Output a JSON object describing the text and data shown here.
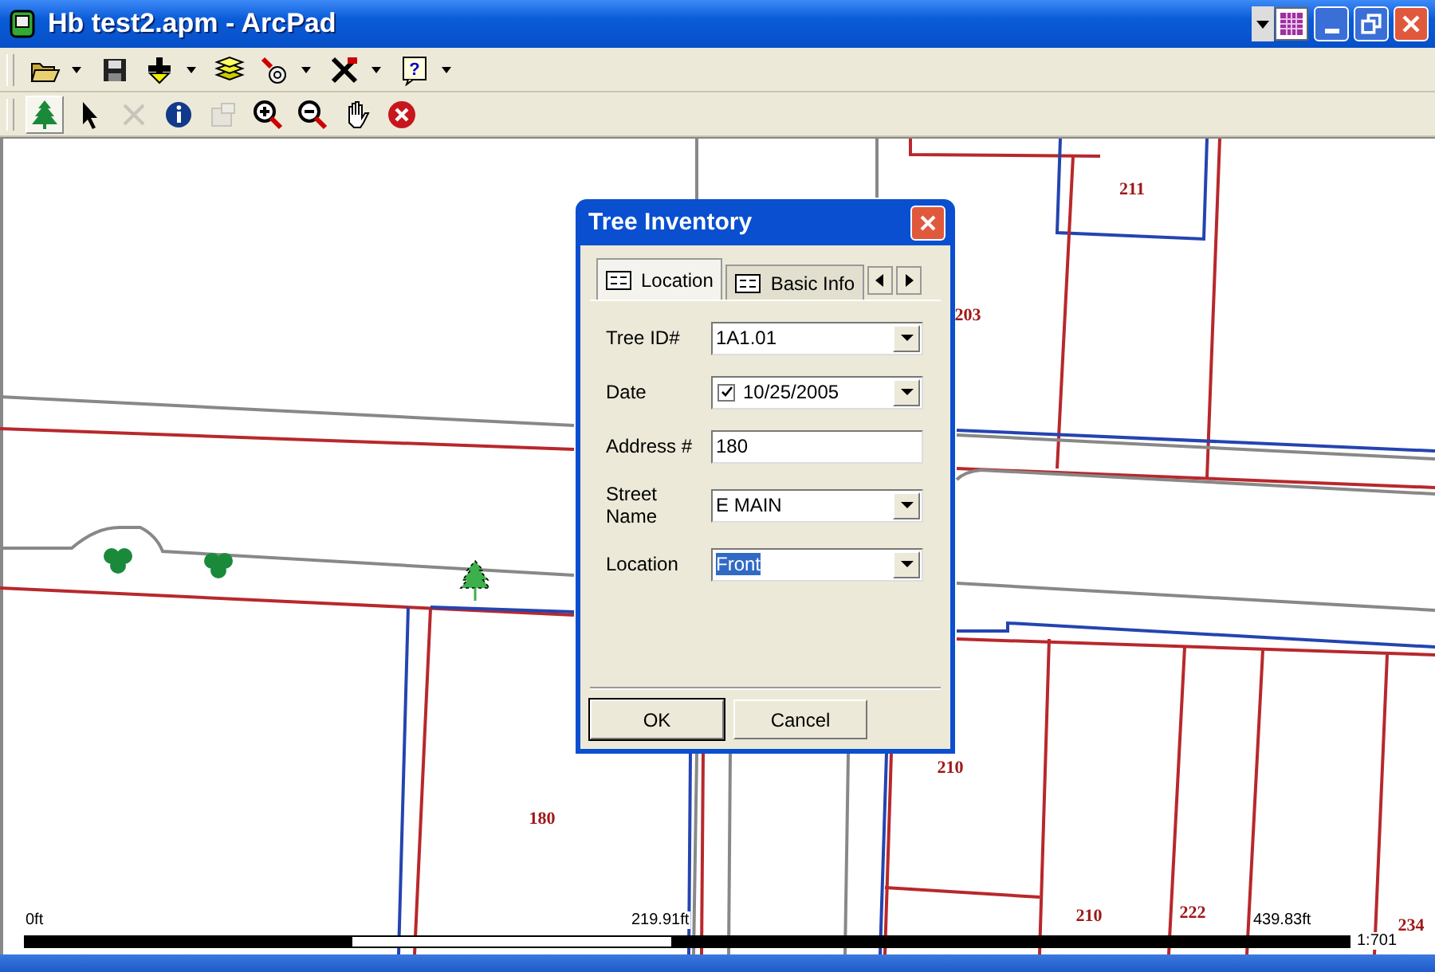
{
  "window": {
    "title": "Hb test2.apm - ArcPad"
  },
  "toolbar_main": [
    {
      "kind": "open",
      "has_menu": true
    },
    {
      "kind": "save",
      "has_menu": false
    },
    {
      "kind": "add",
      "has_menu": true
    },
    {
      "kind": "layers",
      "has_menu": false
    },
    {
      "kind": "gps",
      "has_menu": true
    },
    {
      "kind": "tools",
      "has_menu": true
    },
    {
      "kind": "help",
      "has_menu": true,
      "glyph": "?"
    }
  ],
  "toolbar_browse": [
    {
      "kind": "tree",
      "selected": true,
      "disabled": false
    },
    {
      "kind": "pointer",
      "selected": false,
      "disabled": false
    },
    {
      "kind": "delete",
      "selected": false,
      "disabled": true
    },
    {
      "kind": "info",
      "selected": false,
      "disabled": false
    },
    {
      "kind": "properties",
      "selected": false,
      "disabled": true
    },
    {
      "kind": "zoom-in",
      "selected": false,
      "disabled": false
    },
    {
      "kind": "zoom-out",
      "selected": false,
      "disabled": false
    },
    {
      "kind": "pan",
      "selected": false,
      "disabled": false
    },
    {
      "kind": "stop",
      "selected": false,
      "disabled": false
    }
  ],
  "map": {
    "parcel_labels": [
      "211",
      "203",
      "180",
      "210",
      "210",
      "222",
      "234"
    ],
    "scale_bar": {
      "labels": [
        "0ft",
        "219.91ft",
        "439.83ft"
      ],
      "ratio": "1:701"
    }
  },
  "dialog": {
    "title": "Tree Inventory",
    "tabs": [
      {
        "label": "Location",
        "selected": true
      },
      {
        "label": "Basic Info",
        "selected": false
      }
    ],
    "fields": [
      {
        "label": "Tree ID#",
        "kind": "dropdown",
        "value": "1A1.01",
        "highlighted": false
      },
      {
        "label": "Date",
        "kind": "date",
        "value": "10/25/2005",
        "checked": true
      },
      {
        "label": "Address #",
        "kind": "text",
        "value": "180",
        "highlighted": false
      },
      {
        "label": "Street Name",
        "kind": "dropdown",
        "value": "E MAIN",
        "highlighted": false
      },
      {
        "label": "Location",
        "kind": "dropdown",
        "value": "Front",
        "highlighted": true
      }
    ],
    "buttons": [
      {
        "label": "OK",
        "default": true
      },
      {
        "label": "Cancel",
        "default": false
      }
    ]
  }
}
